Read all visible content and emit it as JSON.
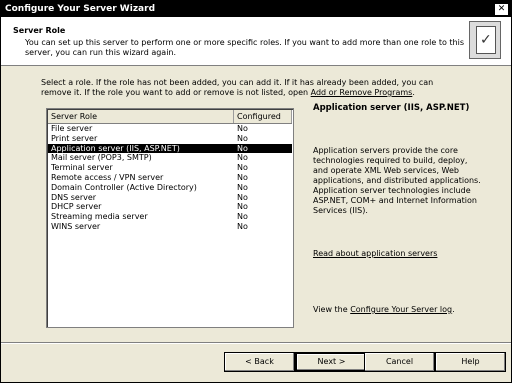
{
  "window": {
    "title": "Configure Your Server Wizard",
    "close_glyph": "✕"
  },
  "header": {
    "title": "Server Role",
    "description": "You can set up this server to perform one or more specific roles. If you want to add more than one role to this server, you can run this wizard again."
  },
  "instructions": {
    "text": "Select a role. If the role has not been added, you can add it. If it has already been added, you can remove it. If the role you want to add or remove is not listed, open ",
    "link": "Add or Remove Programs",
    "end": "."
  },
  "table": {
    "columns": [
      "Server Role",
      "Configured"
    ],
    "rows": [
      {
        "role": "File server",
        "configured": "No"
      },
      {
        "role": "Print server",
        "configured": "No"
      },
      {
        "role": "Application server (IIS, ASP.NET)",
        "configured": "No",
        "selected": true
      },
      {
        "role": "Mail server (POP3, SMTP)",
        "configured": "No"
      },
      {
        "role": "Terminal server",
        "configured": "No"
      },
      {
        "role": "Remote access / VPN server",
        "configured": "No"
      },
      {
        "role": "Domain Controller (Active Directory)",
        "configured": "No"
      },
      {
        "role": "DNS server",
        "configured": "No"
      },
      {
        "role": "DHCP server",
        "configured": "No"
      },
      {
        "role": "Streaming media server",
        "configured": "No"
      },
      {
        "role": "WINS server",
        "configured": "No"
      }
    ]
  },
  "details": {
    "title": "Application server (IIS, ASP.NET)",
    "body": "Application servers provide the core technologies required to build, deploy, and operate XML Web services, Web applications, and distributed applications. Application server technologies include ASP.NET, COM+ and Internet Information Services (IIS).",
    "link": "Read about application servers"
  },
  "bottom": {
    "prefix": "View the ",
    "link": "Configure Your Server log",
    "suffix": "."
  },
  "buttons": {
    "back": "< Back",
    "next": "Next >",
    "cancel": "Cancel",
    "help": "Help"
  }
}
